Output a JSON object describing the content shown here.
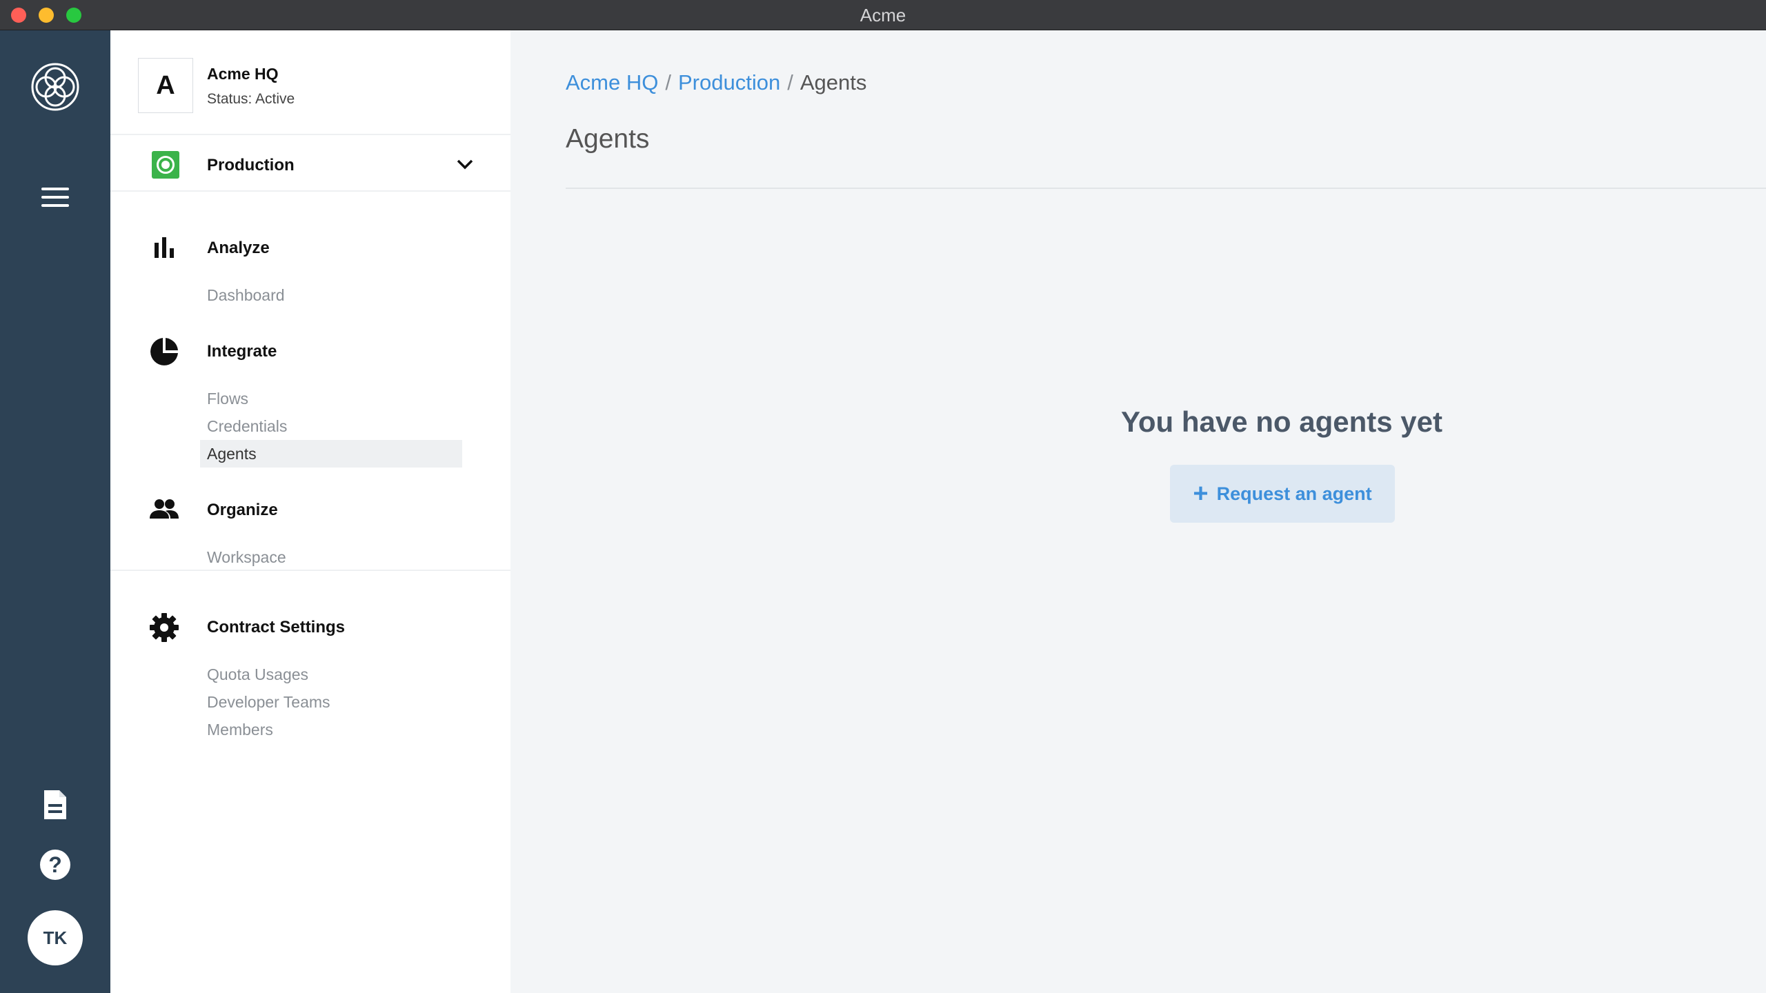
{
  "window": {
    "title": "Acme"
  },
  "rail": {
    "avatar_initials": "TK",
    "help_glyph": "?"
  },
  "org": {
    "badge": "A",
    "name": "Acme HQ",
    "status": "Status: Active"
  },
  "environment": {
    "label": "Production",
    "color": "#3bb34a"
  },
  "nav": {
    "analyze": {
      "label": "Analyze",
      "links": [
        "Dashboard"
      ]
    },
    "integrate": {
      "label": "Integrate",
      "links": [
        "Flows",
        "Credentials",
        "Agents"
      ],
      "active": "Agents"
    },
    "organize": {
      "label": "Organize",
      "links": [
        "Workspace"
      ]
    },
    "contract": {
      "label": "Contract Settings",
      "links": [
        "Quota Usages",
        "Developer Teams",
        "Members"
      ]
    }
  },
  "breadcrumb": {
    "items": [
      "Acme HQ",
      "Production"
    ],
    "current": "Agents",
    "separator": "/"
  },
  "page": {
    "title": "Agents"
  },
  "empty_state": {
    "heading": "You have no agents yet",
    "button_icon": "+",
    "button_label": "Request an agent"
  },
  "colors": {
    "rail": "#2d4255",
    "link": "#3d8fdb",
    "button_bg": "#dde8f3"
  }
}
